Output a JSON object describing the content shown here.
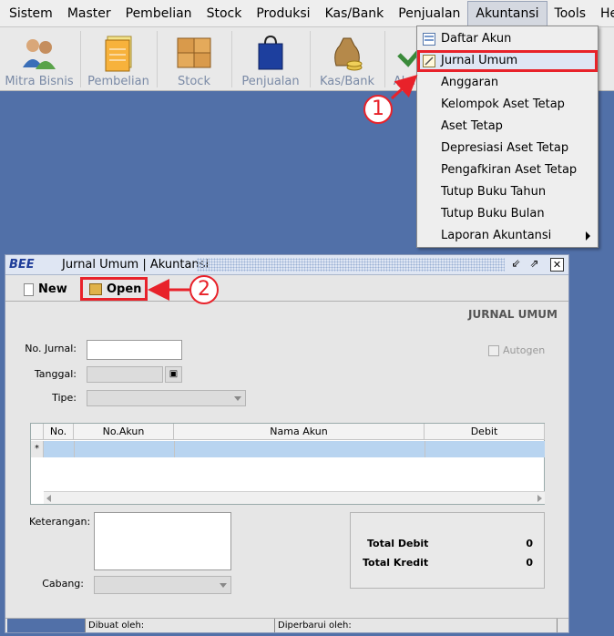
{
  "menubar": {
    "items": [
      {
        "label": "Sistem"
      },
      {
        "label": "Master"
      },
      {
        "label": "Pembelian"
      },
      {
        "label": "Stock"
      },
      {
        "label": "Produksi"
      },
      {
        "label": "Kas/Bank"
      },
      {
        "label": "Penjualan"
      },
      {
        "label": "Akuntansi"
      },
      {
        "label": "Tools"
      },
      {
        "label": "Help"
      }
    ]
  },
  "toolbar": {
    "items": [
      {
        "label": "Mitra Bisnis",
        "icon": "people-icon"
      },
      {
        "label": "Pembelian",
        "icon": "notebook-icon"
      },
      {
        "label": "Stock",
        "icon": "boxes-icon"
      },
      {
        "label": "Penjualan",
        "icon": "shopping-bag-icon"
      },
      {
        "label": "Kas/Bank",
        "icon": "money-bag-icon"
      },
      {
        "label": "Aku",
        "icon": "check-icon"
      }
    ]
  },
  "dropdown": {
    "items": [
      {
        "label": "Daftar Akun",
        "icon": "list-icon"
      },
      {
        "label": "Jurnal Umum",
        "icon": "journal-icon"
      },
      {
        "label": "Anggaran",
        "icon": ""
      },
      {
        "label": "Kelompok Aset Tetap",
        "icon": ""
      },
      {
        "label": "Aset Tetap",
        "icon": ""
      },
      {
        "label": "Depresiasi Aset Tetap",
        "icon": ""
      },
      {
        "label": "Pengafkiran Aset Tetap",
        "icon": ""
      },
      {
        "label": "Tutup Buku Tahun",
        "icon": ""
      },
      {
        "label": "Tutup Buku Bulan",
        "icon": ""
      },
      {
        "label": "Laporan Akuntansi",
        "icon": "submenu-arrow-icon"
      }
    ]
  },
  "callouts": {
    "one": "1",
    "two": "2"
  },
  "window": {
    "logo": "BEE",
    "title": "Jurnal Umum | Akuntansi",
    "new_label": "New",
    "open_label": "Open",
    "panel_title": "JURNAL UMUM"
  },
  "form": {
    "no_jurnal_label": "No. Jurnal:",
    "tanggal_label": "Tanggal:",
    "tipe_label": "Tipe:",
    "autogen_label": "Autogen",
    "keterangan_label": "Keterangan:",
    "cabang_label": "Cabang:"
  },
  "grid": {
    "columns": [
      "No.",
      "No.Akun",
      "Nama Akun",
      "Debit"
    ],
    "new_row_marker": "*"
  },
  "totals": {
    "debit_label": "Total Debit",
    "debit_value": "0",
    "kredit_label": "Total Kredit",
    "kredit_value": "0"
  },
  "status": {
    "dibuat_label": "Dibuat oleh:",
    "diperbarui_label": "Diperbarui oleh:"
  },
  "colors": {
    "desktop": "#5170a8",
    "highlight": "#e8222a",
    "grid_selected_row": "#b8d4f0"
  }
}
